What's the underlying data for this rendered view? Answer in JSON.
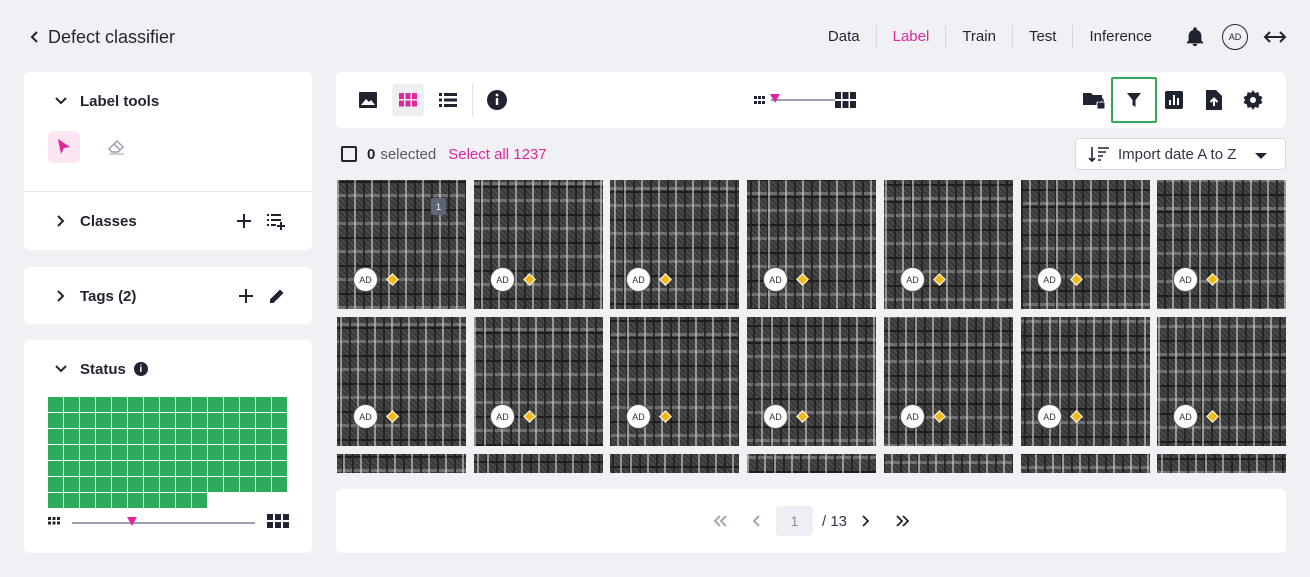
{
  "header": {
    "title": "Defect classifier",
    "tabs": [
      {
        "label": "Data",
        "active": false
      },
      {
        "label": "Label",
        "active": true
      },
      {
        "label": "Train",
        "active": false
      },
      {
        "label": "Test",
        "active": false
      },
      {
        "label": "Inference",
        "active": false
      }
    ],
    "avatar": "AD"
  },
  "sidebar": {
    "label_tools": {
      "title": "Label tools",
      "tools": [
        "select-cursor-icon",
        "brush-eraser-icon"
      ]
    },
    "classes": {
      "title": "Classes"
    },
    "tags": {
      "title": "Tags (2)"
    },
    "status": {
      "title": "Status",
      "info": "i",
      "color": "#2daa5c"
    }
  },
  "toolbar": {
    "view_modes": [
      "image-view-icon",
      "grid-view-icon",
      "list-view-icon"
    ],
    "active_view": "grid-view-icon",
    "info": "info-icon",
    "actions": [
      "folder-lock-icon",
      "filter-icon",
      "chart-icon",
      "export-icon",
      "settings-icon"
    ]
  },
  "selection": {
    "count": "0",
    "text": "selected",
    "select_all": "Select all 1237"
  },
  "sort": {
    "label": "Import date A to Z"
  },
  "thumbnails": {
    "badge": "AD",
    "bookmark": "1"
  },
  "pagination": {
    "current": "1",
    "total": "/ 13"
  },
  "colors": {
    "accent": "#e0269c",
    "status_green": "#2daa5c",
    "label_diamond": "#f2b81c"
  }
}
